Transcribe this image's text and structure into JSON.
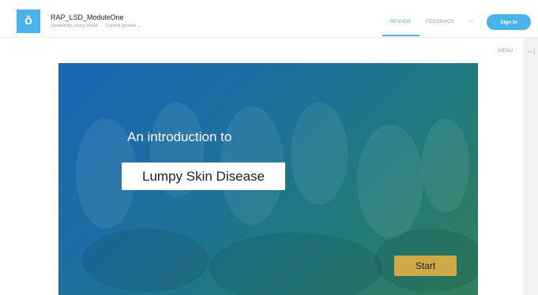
{
  "header": {
    "logo_glyph": "ŏ",
    "doc_title": "RAP_LSD_ModuleOne",
    "created_by": "Created By Jenny Maud",
    "separator": "·",
    "version": "Current Version ⌄",
    "nav_review": "REVIEW",
    "nav_feedback": "FEEDBACK",
    "nav_more": "···",
    "signin_label": "Sign In"
  },
  "side": {
    "menu_label": "MENU",
    "collapse_glyph": "←|"
  },
  "slide": {
    "intro_text": "An introduction to",
    "title_text": "Lumpy Skin Disease",
    "start_label": "Start"
  },
  "colors": {
    "accent": "#49b3ec",
    "start_button": "#cfa847",
    "gradient_start": "#1967b5",
    "gradient_end": "#2f7f5a"
  }
}
